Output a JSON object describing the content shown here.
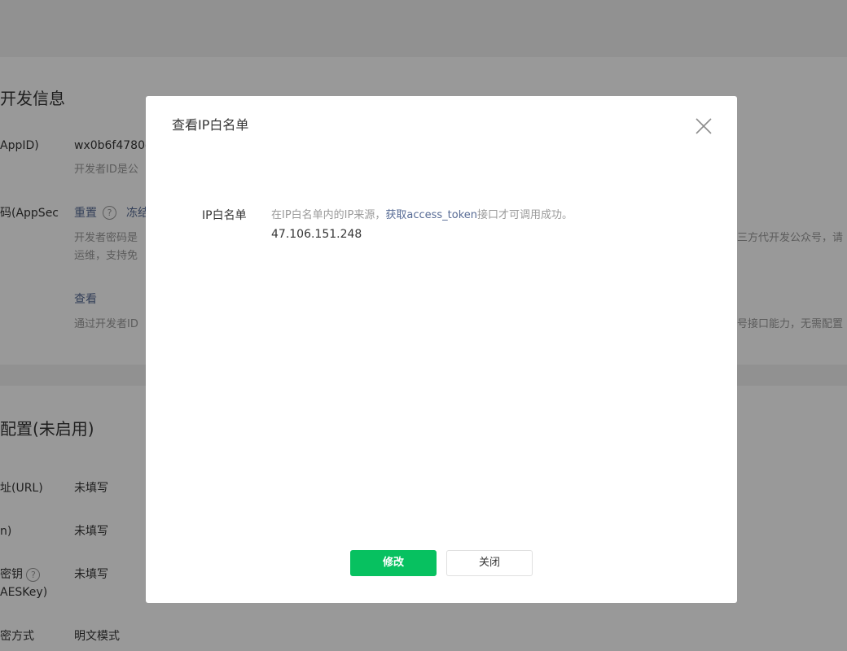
{
  "background": {
    "dev_info": {
      "section_title": "开发信息",
      "appid_label": "AppID)",
      "appid_value": "wx0b6f4780e",
      "appid_desc": "开发者ID是公",
      "secret_label": "码(AppSec",
      "reset_link": "重置",
      "freeze_link": "冻结",
      "secret_desc_line1": "开发者密码是",
      "secret_desc_line2": "运维，支持免",
      "secret_desc_right": "三方代开发公众号，请",
      "view_link": "查看",
      "ip_desc_left": "通过开发者ID",
      "ip_desc_right": "号接口能力，无需配置"
    },
    "server_config": {
      "section_title": "配置(未启用)",
      "url_label": "址(URL)",
      "url_value": "未填写",
      "token_label": "n)",
      "token_value": "未填写",
      "aeskey_label_line1": "密钥",
      "aeskey_label_line2": "AESKey)",
      "aeskey_value": "未填写",
      "encrypt_label": "密方式",
      "encrypt_value": "明文模式"
    }
  },
  "dialog": {
    "title": "查看IP白名单",
    "field_label": "IP白名单",
    "tip_prefix": "在IP白名单内的IP来源，",
    "tip_link": "获取access_token",
    "tip_suffix": "接口才可调用成功。",
    "ip_value": "47.106.151.248",
    "modify_button": "修改",
    "close_button": "关闭"
  },
  "colors": {
    "primary_green": "#07c160",
    "link_blue": "#576b95",
    "tip_gray": "#9a9a9a",
    "mask": "rgba(0,0,0,0.4)"
  },
  "icons": {
    "close": "close-icon",
    "help": "help-icon"
  }
}
